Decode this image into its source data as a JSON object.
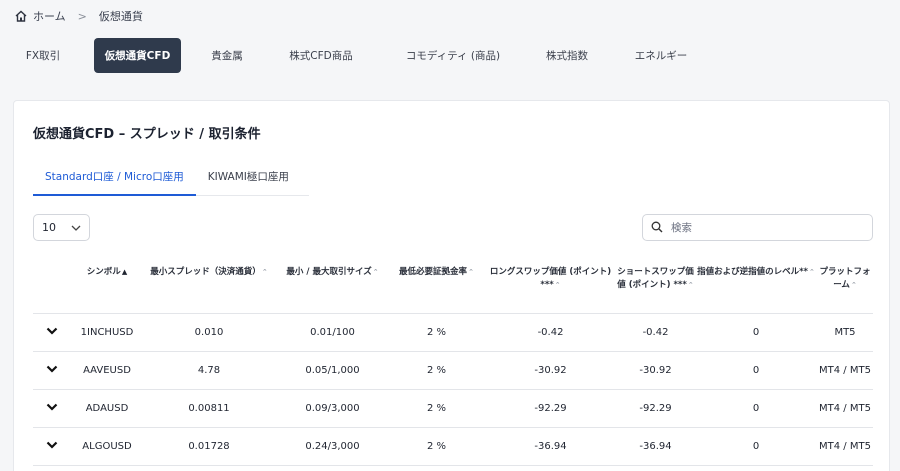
{
  "breadcrumb": {
    "home": "ホーム",
    "separator": ">",
    "current": "仮想通貨"
  },
  "category_tabs": [
    {
      "label": "FX取引",
      "active": false
    },
    {
      "label": "仮想通貨CFD",
      "active": true
    },
    {
      "label": "貴金属",
      "active": false
    },
    {
      "label": "株式CFD商品",
      "active": false
    },
    {
      "label": "コモディティ (商品)",
      "active": false
    },
    {
      "label": "株式指数",
      "active": false
    },
    {
      "label": "エネルギー",
      "active": false
    }
  ],
  "card": {
    "title": "仮想通貨CFD – スプレッド / 取引条件",
    "account_tabs": [
      {
        "label": "Standard口座 / Micro口座用",
        "active": true
      },
      {
        "label": "KIWAMI極口座用",
        "active": false
      }
    ],
    "page_size": "10",
    "search_placeholder": "検索"
  },
  "table": {
    "headers": [
      {
        "label": "シンボル",
        "sort": "asc"
      },
      {
        "label": "最小スプレッド（決済通貨）",
        "sort": "none"
      },
      {
        "label": "最小 / 最大取引サイズ",
        "sort": "none"
      },
      {
        "label": "最低必要証拠金率",
        "sort": "none"
      },
      {
        "label": "ロングスワップ価値 (ポイント) ***",
        "sort": "none"
      },
      {
        "label": "ショートスワップ価値 (ポイント) ***",
        "sort": "none"
      },
      {
        "label": "指値および逆指値のレベル**",
        "sort": "none"
      },
      {
        "label": "プラットフォーム",
        "sort": "none"
      }
    ],
    "rows": [
      {
        "symbol": "1INCHUSD",
        "spread": "0.010",
        "size": "0.01/100",
        "margin": "2 %",
        "long_swap": "-0.42",
        "short_swap": "-0.42",
        "level": "0",
        "platform": "MT5"
      },
      {
        "symbol": "AAVEUSD",
        "spread": "4.78",
        "size": "0.05/1,000",
        "margin": "2 %",
        "long_swap": "-30.92",
        "short_swap": "-30.92",
        "level": "0",
        "platform": "MT4 / MT5"
      },
      {
        "symbol": "ADAUSD",
        "spread": "0.00811",
        "size": "0.09/3,000",
        "margin": "2 %",
        "long_swap": "-92.29",
        "short_swap": "-92.29",
        "level": "0",
        "platform": "MT4 / MT5"
      },
      {
        "symbol": "ALGOUSD",
        "spread": "0.01728",
        "size": "0.24/3,000",
        "margin": "2 %",
        "long_swap": "-36.94",
        "short_swap": "-36.94",
        "level": "0",
        "platform": "MT4 / MT5"
      }
    ]
  },
  "colors": {
    "active_tab_bg": "#2f3a4c",
    "accent": "#1e5bd6"
  },
  "icons": {
    "home": "home-icon",
    "chevron_down": "chevron-down-icon",
    "search": "search-icon"
  }
}
